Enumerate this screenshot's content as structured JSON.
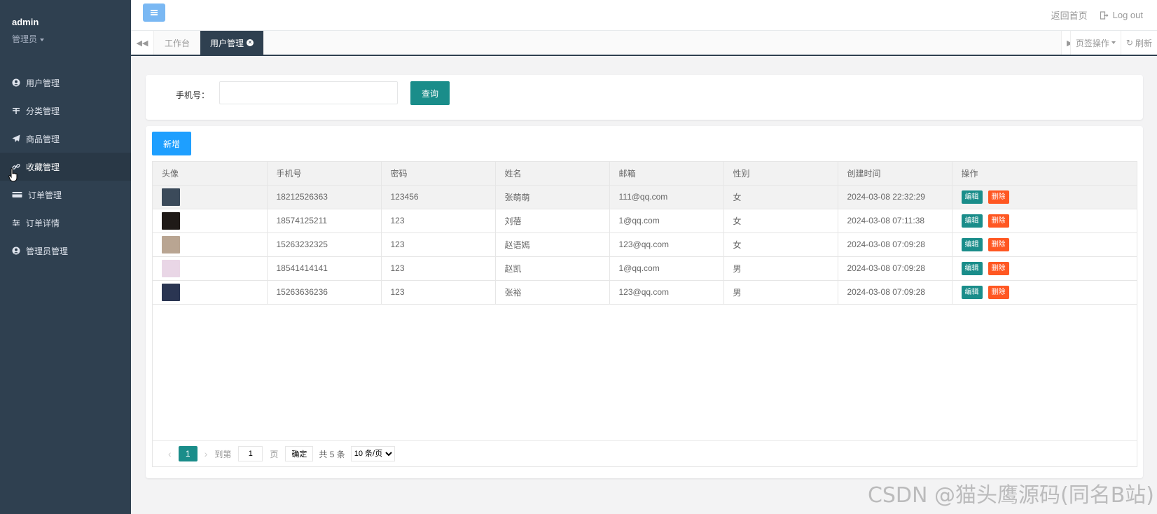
{
  "profile": {
    "name": "admin",
    "role": "管理员"
  },
  "sidebar": {
    "items": [
      {
        "label": "用户管理",
        "icon": "user-circle-icon"
      },
      {
        "label": "分类管理",
        "icon": "category-icon"
      },
      {
        "label": "商品管理",
        "icon": "paper-plane-icon"
      },
      {
        "label": "收藏管理",
        "icon": "link-icon"
      },
      {
        "label": "订单管理",
        "icon": "credit-card-icon"
      },
      {
        "label": "订单详情",
        "icon": "sliders-icon"
      },
      {
        "label": "管理员管理",
        "icon": "user-circle-icon"
      }
    ],
    "active_index": 3
  },
  "topbar": {
    "home_label": "返回首页",
    "logout_label": "Log out"
  },
  "tabs": {
    "items": [
      {
        "label": "工作台",
        "active": false
      },
      {
        "label": "用户管理",
        "active": true
      }
    ],
    "ops_label": "页签操作",
    "refresh_label": "刷新"
  },
  "search": {
    "label": "手机号：",
    "value": "",
    "placeholder": "",
    "button_label": "查询"
  },
  "toolbar": {
    "add_label": "新增"
  },
  "table": {
    "columns": [
      "头像",
      "手机号",
      "密码",
      "姓名",
      "邮箱",
      "性别",
      "创建时间",
      "操作"
    ],
    "rows": [
      {
        "phone": "18212526363",
        "password": "123456",
        "name": "张萌萌",
        "email": "111@qq.com",
        "gender": "女",
        "created": "2024-03-08 22:32:29",
        "avatar_color": "#3b4a5a"
      },
      {
        "phone": "18574125211",
        "password": "123",
        "name": "刘蓓",
        "email": "1@qq.com",
        "gender": "女",
        "created": "2024-03-08 07:11:38",
        "avatar_color": "#1f1a17"
      },
      {
        "phone": "15263232325",
        "password": "123",
        "name": "赵语嫣",
        "email": "123@qq.com",
        "gender": "女",
        "created": "2024-03-08 07:09:28",
        "avatar_color": "#b9a592"
      },
      {
        "phone": "18541414141",
        "password": "123",
        "name": "赵凯",
        "email": "1@qq.com",
        "gender": "男",
        "created": "2024-03-08 07:09:28",
        "avatar_color": "#e9d6e6"
      },
      {
        "phone": "15263636236",
        "password": "123",
        "name": "张裕",
        "email": "123@qq.com",
        "gender": "男",
        "created": "2024-03-08 07:09:28",
        "avatar_color": "#2a3552"
      }
    ],
    "edit_label": "编辑",
    "delete_label": "删除"
  },
  "pager": {
    "current_page": "1",
    "goto_label": "到第",
    "page_input": "1",
    "page_unit": "页",
    "confirm_label": "确定",
    "total_label": "共 5 条",
    "size_option": "10 条/页"
  },
  "watermark": "CSDN @猫头鹰源码(同名B站)",
  "colors": {
    "sidebar_bg": "#2f4050",
    "primary": "#1a8d8a",
    "add_blue": "#1e9fff",
    "danger": "#ff5722"
  }
}
